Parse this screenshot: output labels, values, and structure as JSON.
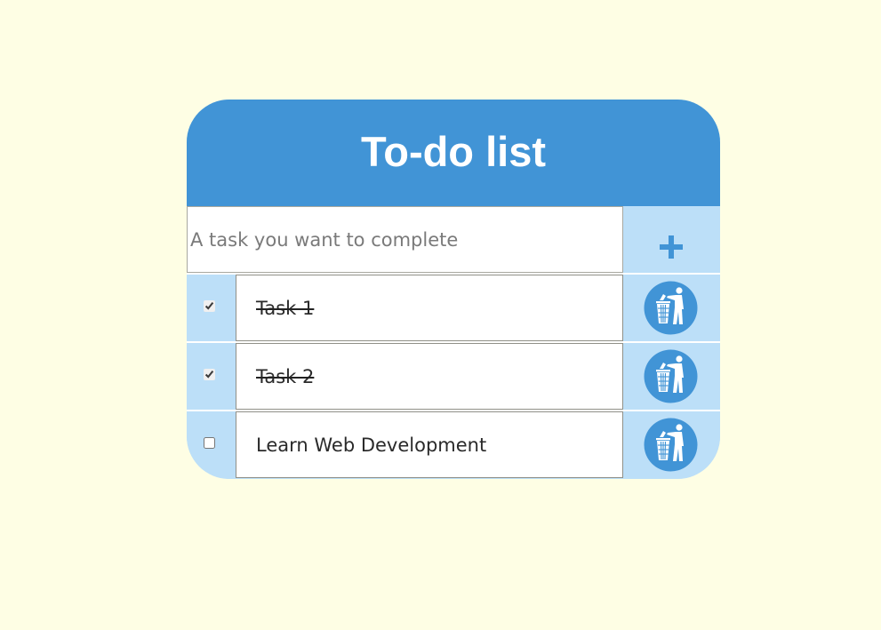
{
  "app": {
    "title": "To-do list"
  },
  "new_task": {
    "placeholder": "A task you want to complete",
    "value": "",
    "add_icon": "plus-icon"
  },
  "tasks": [
    {
      "label": "Task 1",
      "checked": true
    },
    {
      "label": "Task 2",
      "checked": true
    },
    {
      "label": "Learn Web Development",
      "checked": false
    }
  ],
  "delete_icon": "trash-bin-person-icon",
  "colors": {
    "background": "#fefee4",
    "header": "#4194d6",
    "accent_light": "#bcdff8",
    "title_text": "#ffffff"
  }
}
